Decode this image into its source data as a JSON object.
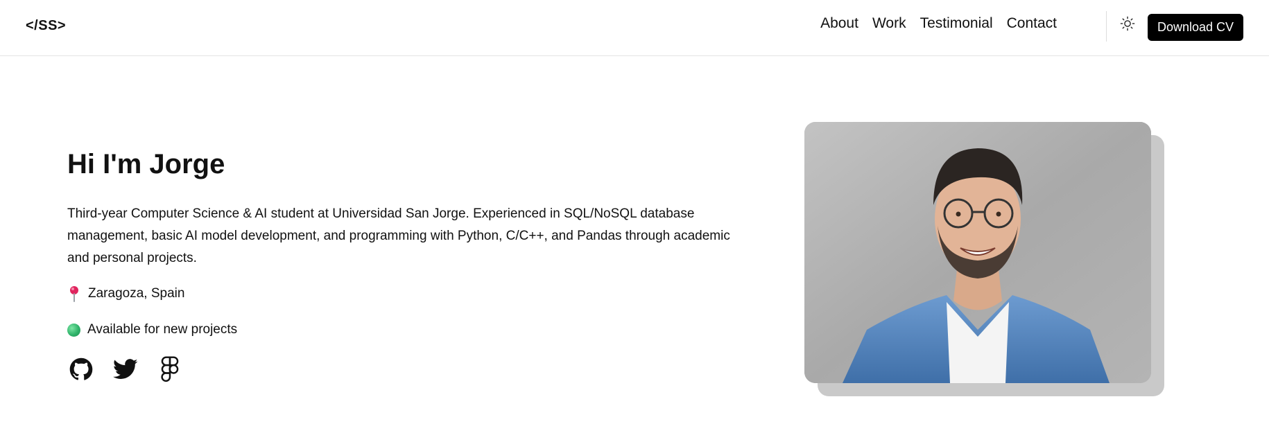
{
  "header": {
    "logo": "</SS>",
    "nav": [
      {
        "label": "About"
      },
      {
        "label": "Work"
      },
      {
        "label": "Testimonial"
      },
      {
        "label": "Contact"
      }
    ],
    "theme_icon": "sun-icon",
    "cta_label": "Download CV"
  },
  "hero": {
    "title": "Hi I'm Jorge",
    "bio": "Third-year Computer Science & AI student at Universidad San Jorge. Experienced in SQL/NoSQL database management, basic AI model development, and programming with Python, C/C++, and Pandas through academic and personal projects.",
    "location": "Zaragoza, Spain",
    "availability": "Available for new projects",
    "socials": [
      {
        "icon": "github-icon"
      },
      {
        "icon": "twitter-icon"
      },
      {
        "icon": "figma-icon"
      }
    ]
  },
  "portrait": {
    "description_icon": "portrait-image"
  },
  "colors": {
    "accent": "#000000",
    "status": "#2fb36a",
    "pin": "#e0245e"
  }
}
